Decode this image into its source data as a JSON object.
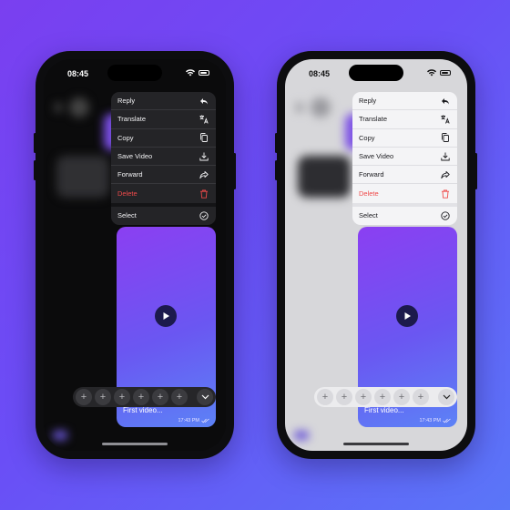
{
  "status_bar": {
    "time": "08:45"
  },
  "menu": {
    "items": [
      {
        "label": "Reply",
        "icon": "reply-icon"
      },
      {
        "label": "Translate",
        "icon": "translate-icon"
      },
      {
        "label": "Copy",
        "icon": "copy-icon"
      },
      {
        "label": "Save Video",
        "icon": "download-icon"
      },
      {
        "label": "Forward",
        "icon": "forward-icon"
      },
      {
        "label": "Delete",
        "icon": "trash-icon",
        "danger": true
      }
    ],
    "select": {
      "label": "Select",
      "icon": "check-circle-icon"
    }
  },
  "message": {
    "caption": "First video...",
    "time": "17:43 PM",
    "status_icon": "double-check-icon"
  },
  "reactions": {
    "add_icon": "plus-icon",
    "count": 6,
    "expand_icon": "chevron-down-icon"
  },
  "colors": {
    "background_start": "#7a3ff0",
    "background_end": "#5a76f8",
    "danger": "#ef4a4a",
    "video_gradient_start": "#8b3ff2",
    "video_gradient_end": "#5c82f6"
  }
}
